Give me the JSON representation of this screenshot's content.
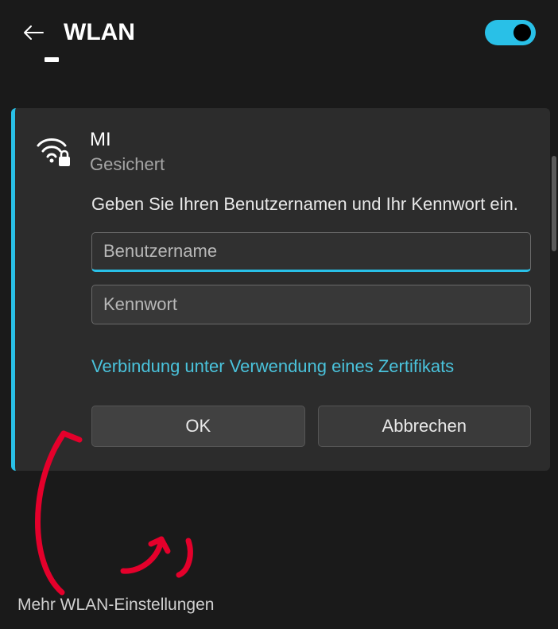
{
  "header": {
    "title": "WLAN",
    "toggle_on": true
  },
  "network": {
    "name": "MI",
    "status": "Gesichert",
    "prompt": "Geben Sie Ihren Benutzernamen und Ihr Kennwort ein.",
    "username_placeholder": "Benutzername",
    "password_placeholder": "Kennwort",
    "cert_link": "Verbindung unter Verwendung eines Zertifikats",
    "ok_label": "OK",
    "cancel_label": "Abbrechen"
  },
  "footer": {
    "more_settings": "Mehr WLAN-Einstellungen"
  }
}
